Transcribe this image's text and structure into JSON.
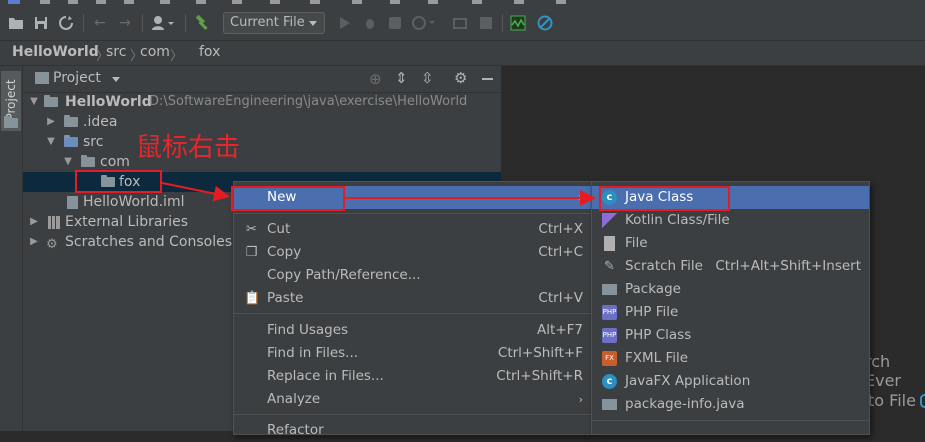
{
  "toolbar": {
    "run_config": "Current File"
  },
  "breadcrumb": [
    "HelloWorld",
    "src",
    "com",
    "fox"
  ],
  "left_stripe": {
    "project_tab": "Project"
  },
  "project_panel": {
    "title": "Project",
    "tree": {
      "root_name": "HelloWorld",
      "root_path": "D:\\SoftwareEngineering\\java\\exercise\\HelloWorld",
      "idea": ".idea",
      "src": "src",
      "com": "com",
      "fox": "fox",
      "iml": "HelloWorld.iml",
      "ext_libs": "External Libraries",
      "scratches": "Scratches and Consoles"
    }
  },
  "annotation": {
    "right_click_text": "鼠标右击"
  },
  "context_menu": {
    "new": "New",
    "cut": {
      "label": "Cut",
      "shortcut": "Ctrl+X"
    },
    "copy": {
      "label": "Copy",
      "shortcut": "Ctrl+C"
    },
    "copy_path": "Copy Path/Reference...",
    "paste": {
      "label": "Paste",
      "shortcut": "Ctrl+V"
    },
    "find_usages": {
      "label": "Find Usages",
      "shortcut": "Alt+F7"
    },
    "find_in_files": {
      "label": "Find in Files...",
      "shortcut": "Ctrl+Shift+F"
    },
    "replace_in_files": {
      "label": "Replace in Files...",
      "shortcut": "Ctrl+Shift+R"
    },
    "analyze": "Analyze",
    "refactor": "Refactor"
  },
  "new_submenu": {
    "java_class": "Java Class",
    "kotlin_class": "Kotlin Class/File",
    "file": "File",
    "scratch_file": {
      "label": "Scratch File",
      "shortcut": "Ctrl+Alt+Shift+Insert"
    },
    "package": "Package",
    "php_file": "PHP File",
    "php_class": "PHP Class",
    "fxml_file": "FXML File",
    "javafx_app": "JavaFX Application",
    "package_info": "package-info.java"
  },
  "editor_hints": {
    "search_everywhere": "rch Ever",
    "go_to_file": "to File"
  },
  "colors": {
    "selection": "#4b6eaf",
    "annotation_red": "#e51c23",
    "background": "#2b2b2b",
    "panel": "#3c3f41"
  }
}
